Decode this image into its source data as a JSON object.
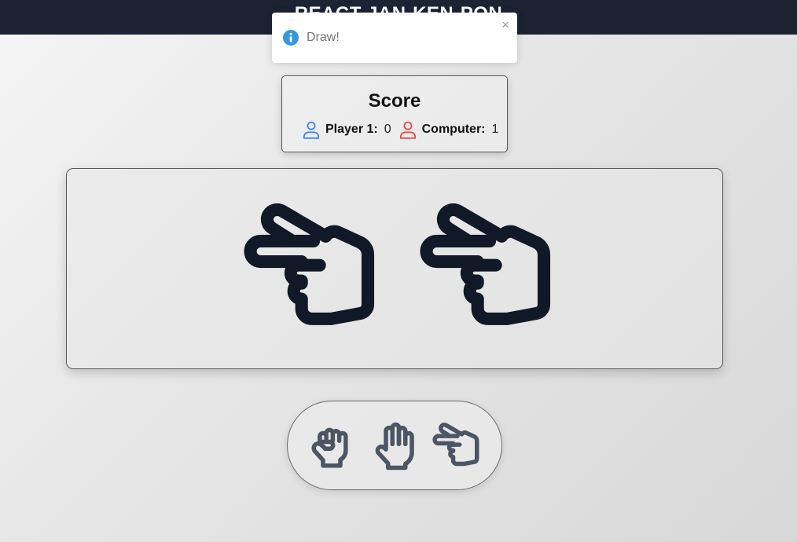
{
  "header": {
    "title": "REACT JAN-KEN-PON"
  },
  "toast": {
    "message": "Draw!",
    "close_glyph": "×",
    "icon": "info-circle-icon",
    "icon_color": "#3498db"
  },
  "score": {
    "title": "Score",
    "player": {
      "label": "Player 1:",
      "value": "0",
      "icon": "user-icon",
      "color": "#3b82f6"
    },
    "computer": {
      "label": "Computer:",
      "value": "1",
      "icon": "user-icon",
      "color": "#ef4444"
    }
  },
  "arena": {
    "player_choice": "scissors",
    "computer_choice": "scissors",
    "hand_color": "#111827"
  },
  "picker": {
    "options": [
      "rock",
      "paper",
      "scissors"
    ],
    "icon_color": "#4b5563"
  }
}
